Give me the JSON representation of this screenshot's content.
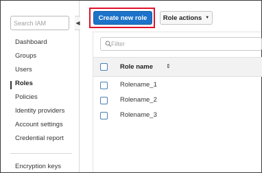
{
  "sidebar": {
    "search_placeholder": "Search IAM",
    "collapse_glyph": "◀",
    "items": [
      {
        "label": "Dashboard",
        "active": false
      },
      {
        "label": "Groups",
        "active": false
      },
      {
        "label": "Users",
        "active": false
      },
      {
        "label": "Roles",
        "active": true
      },
      {
        "label": "Policies",
        "active": false
      },
      {
        "label": "Identity providers",
        "active": false
      },
      {
        "label": "Account settings",
        "active": false
      },
      {
        "label": "Credential report",
        "active": false
      }
    ],
    "bottom_items": [
      {
        "label": "Encryption keys"
      }
    ]
  },
  "toolbar": {
    "create_label": "Create new role",
    "actions_label": "Role actions",
    "actions_caret": "▼"
  },
  "filter": {
    "placeholder": "Filter",
    "icon": "search-icon"
  },
  "table": {
    "header": "Role name",
    "sort_glyph": "⇕",
    "rows": [
      {
        "name": "Rolename_1"
      },
      {
        "name": "Rolename_2"
      },
      {
        "name": "Rolename_3"
      }
    ]
  },
  "colors": {
    "primary": "#1d73c9",
    "highlight": "#e0102a",
    "checkbox": "#4b7fb0"
  }
}
